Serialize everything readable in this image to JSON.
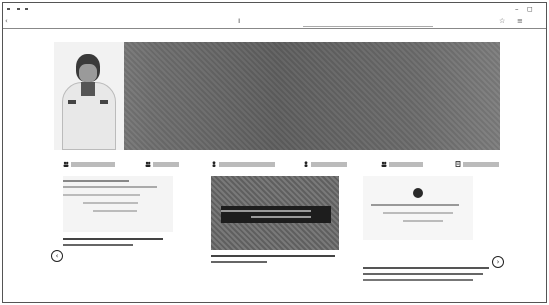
{
  "browser": {
    "tab_title": "",
    "url": "",
    "window_controls": [
      "–",
      "◻"
    ],
    "toolbar_icons": [
      "star-icon",
      "menu-icon"
    ]
  },
  "banner": {
    "title": "",
    "subtitle": "",
    "portrait_caption": "",
    "colors": {
      "banner": "#6e6e6e",
      "title_text": "#ffffff"
    }
  },
  "menu": {
    "items": [
      {
        "label": "",
        "icon": "people-icon"
      },
      {
        "label": "",
        "icon": "people-icon"
      },
      {
        "label": "",
        "icon": "person-icon"
      },
      {
        "label": "",
        "icon": "person-icon"
      },
      {
        "label": "",
        "icon": "people-icon"
      },
      {
        "label": "",
        "icon": "document-icon"
      }
    ]
  },
  "cards": [
    {
      "caption": ""
    },
    {
      "overlay_text": "",
      "caption": ""
    },
    {
      "header": "",
      "caption": ""
    }
  ],
  "carousel": {
    "prev_icon": "‹",
    "next_icon": "›"
  }
}
